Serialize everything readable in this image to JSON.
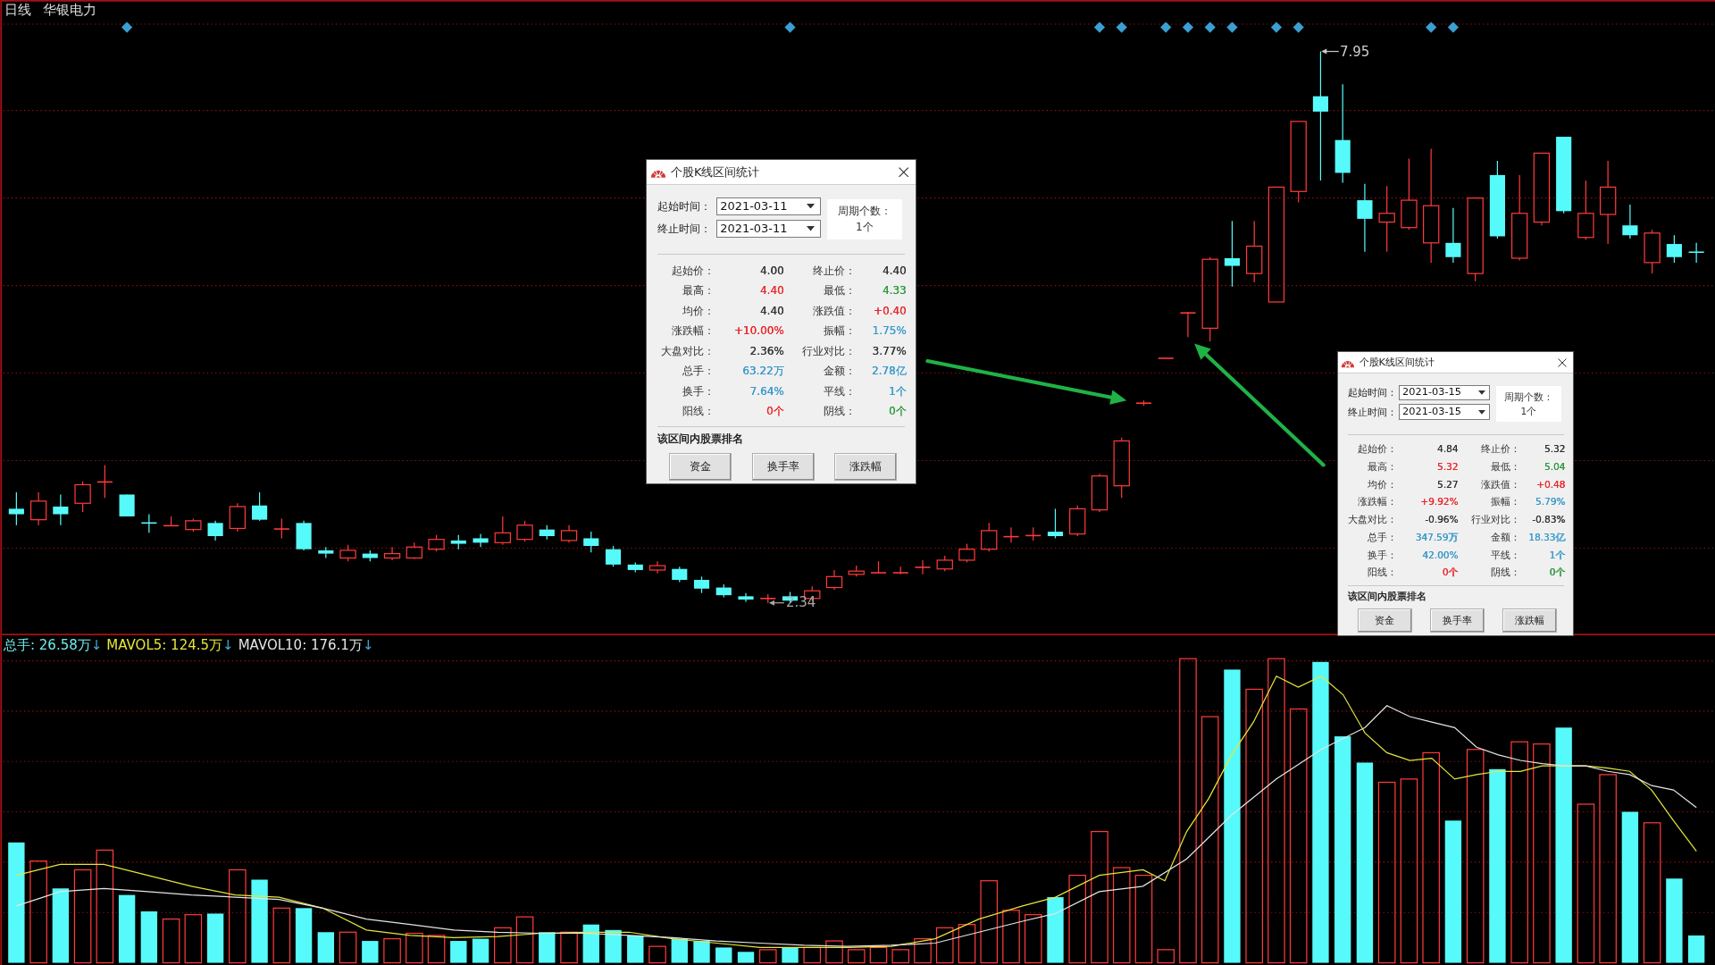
{
  "chart_header": {
    "period": "日线",
    "stock_name": "华银电力"
  },
  "price_chart": {
    "high_label": "7.95",
    "low_label": "2.34"
  },
  "volume_legend": [
    {
      "text": "总手: 26.58万",
      "arrow": "↓",
      "color": "#6fecec"
    },
    {
      "text": "MAVOL5: 124.5万",
      "arrow": "↓",
      "color": "#e6e63a"
    },
    {
      "text": "MAVOL10: 176.1万",
      "arrow": "↓",
      "color": "#e4e4e4"
    }
  ],
  "dialogs": [
    {
      "title": "个股K线区间统计",
      "start": {
        "label": "起始时间：",
        "value": "2021-03-11"
      },
      "end": {
        "label": "终止时间：",
        "value": "2021-03-11"
      },
      "period": {
        "label": "周期个数：",
        "value": "1个"
      },
      "stats": [
        {
          "label": "起始价：",
          "value": "4.00",
          "color": "#333333"
        },
        {
          "label": "终止价：",
          "value": "4.40",
          "color": "#333333"
        },
        {
          "label": "最高：",
          "value": "4.40",
          "color": "#e8282e"
        },
        {
          "label": "最低：",
          "value": "4.33",
          "color": "#2f9a3f"
        },
        {
          "label": "均价：",
          "value": "4.40",
          "color": "#333333"
        },
        {
          "label": "涨跌值：",
          "value": "+0.40",
          "color": "#e8282e"
        },
        {
          "label": "涨跌幅：",
          "value": "+10.00%",
          "color": "#e8282e"
        },
        {
          "label": "振幅：",
          "value": "1.75%",
          "color": "#3a9ac9"
        },
        {
          "label": "大盘对比：",
          "value": "2.36%",
          "color": "#333333"
        },
        {
          "label": "行业对比：",
          "value": "3.77%",
          "color": "#333333"
        },
        {
          "label": "总手：",
          "value": "63.22万",
          "color": "#3a9ac9"
        },
        {
          "label": "金额：",
          "value": "2.78亿",
          "color": "#3a9ac9"
        },
        {
          "label": "换手：",
          "value": "7.64%",
          "color": "#3a9ac9"
        },
        {
          "label": "平线：",
          "value": "1个",
          "color": "#3a9ac9"
        },
        {
          "label": "阳线：",
          "value": "0个",
          "color": "#e8282e"
        },
        {
          "label": "阴线：",
          "value": "0个",
          "color": "#2f9a3f"
        }
      ],
      "ranking_title": "该区间内股票排名",
      "buttons": [
        "资金",
        "换手率",
        "涨跌幅"
      ]
    },
    {
      "title": "个股K线区间统计",
      "start": {
        "label": "起始时间：",
        "value": "2021-03-15"
      },
      "end": {
        "label": "终止时间：",
        "value": "2021-03-15"
      },
      "period": {
        "label": "周期个数：",
        "value": "1个"
      },
      "stats": [
        {
          "label": "起始价：",
          "value": "4.84",
          "color": "#333333"
        },
        {
          "label": "终止价：",
          "value": "5.32",
          "color": "#333333"
        },
        {
          "label": "最高：",
          "value": "5.32",
          "color": "#e8282e"
        },
        {
          "label": "最低：",
          "value": "5.04",
          "color": "#2f9a3f"
        },
        {
          "label": "均价：",
          "value": "5.27",
          "color": "#333333"
        },
        {
          "label": "涨跌值：",
          "value": "+0.48",
          "color": "#e8282e"
        },
        {
          "label": "涨跌幅：",
          "value": "+9.92%",
          "color": "#e8282e"
        },
        {
          "label": "振幅：",
          "value": "5.79%",
          "color": "#3a9ac9"
        },
        {
          "label": "大盘对比：",
          "value": "-0.96%",
          "color": "#333333"
        },
        {
          "label": "行业对比：",
          "value": "-0.83%",
          "color": "#333333"
        },
        {
          "label": "总手：",
          "value": "347.59万",
          "color": "#3a9ac9"
        },
        {
          "label": "金额：",
          "value": "18.33亿",
          "color": "#3a9ac9"
        },
        {
          "label": "换手：",
          "value": "42.00%",
          "color": "#3a9ac9"
        },
        {
          "label": "平线：",
          "value": "1个",
          "color": "#3a9ac9"
        },
        {
          "label": "阳线：",
          "value": "0个",
          "color": "#e8282e"
        },
        {
          "label": "阴线：",
          "value": "0个",
          "color": "#2f9a3f"
        }
      ],
      "ranking_title": "该区间内股票排名",
      "buttons": [
        "资金",
        "换手率",
        "涨跌幅"
      ]
    }
  ]
}
